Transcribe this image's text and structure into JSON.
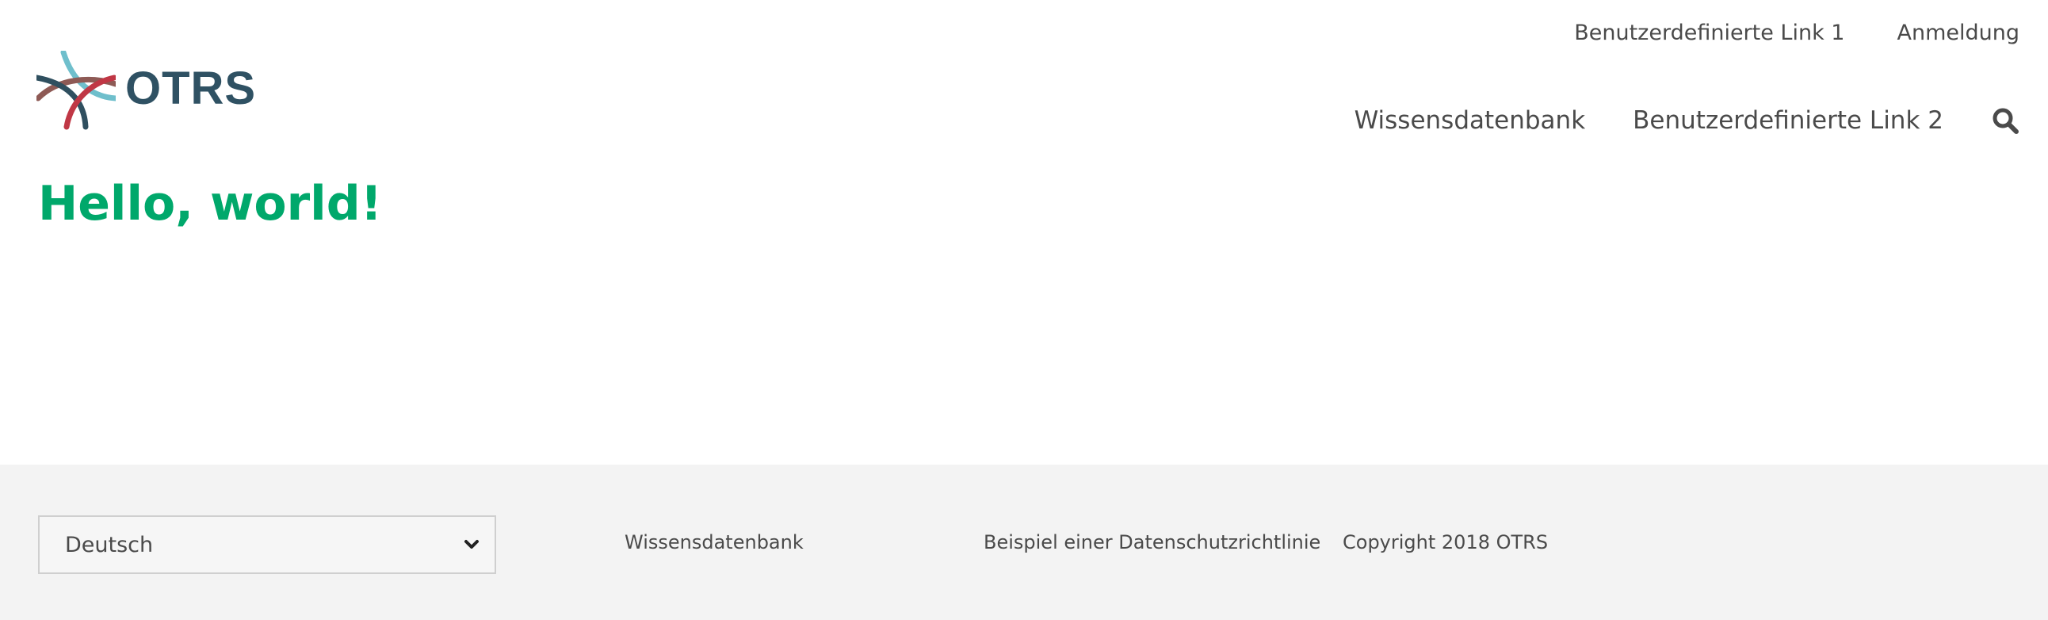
{
  "header": {
    "logo_text": "OTRS",
    "top_links": [
      {
        "label": "Benutzerdefinierte Link 1"
      },
      {
        "label": "Anmeldung"
      }
    ],
    "main_nav": [
      {
        "label": "Wissensdatenbank"
      },
      {
        "label": "Benutzerdefinierte Link 2"
      }
    ],
    "search_icon": "search-icon"
  },
  "main": {
    "title": "Hello, world!"
  },
  "footer": {
    "language_select": {
      "value": "Deutsch",
      "icon": "chevron-down-icon"
    },
    "links": [
      {
        "label": "Wissensdatenbank"
      },
      {
        "label": "Beispiel einer Datenschutzrichtlinie"
      }
    ],
    "copyright": "Copyright 2018 OTRS"
  },
  "colors": {
    "accent": "#00a86b",
    "brand": "#2f5163",
    "footer_bg": "#f3f3f3",
    "text": "#4a4a4a"
  }
}
